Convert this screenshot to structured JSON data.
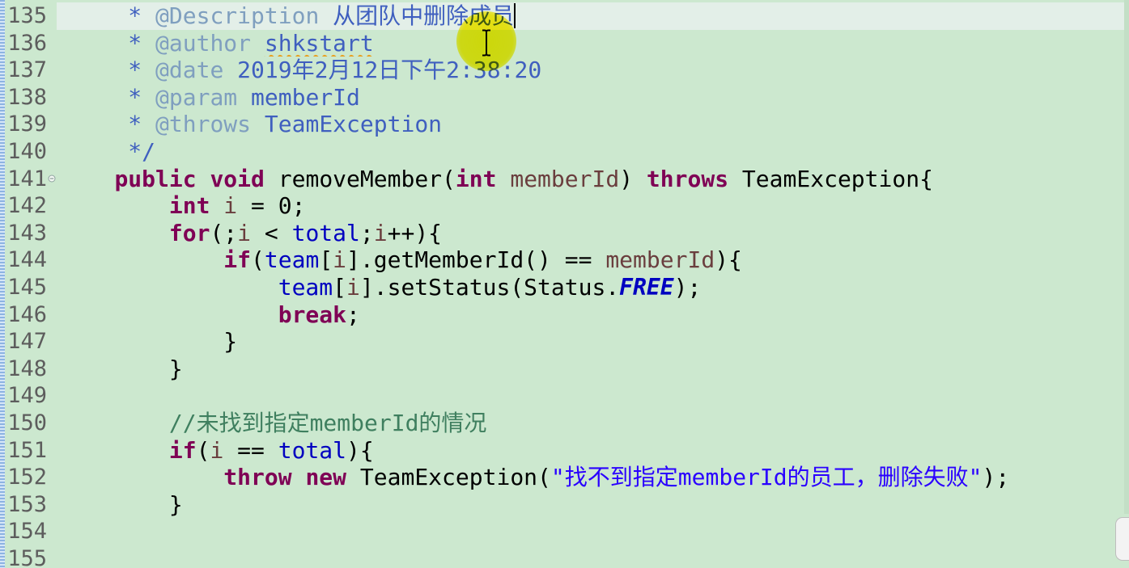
{
  "editor": {
    "colors": {
      "background": "#cce8cf",
      "current_line": "#e3efe8"
    },
    "syntax_colors": {
      "default": "#000000",
      "javadoc": "#3f5fbf",
      "javadoc_tag": "#7f9fbf",
      "keyword": "#7f0055",
      "local": "#6a3e3e",
      "field": "#0000c0",
      "comment": "#3f7f5f",
      "string": "#2a00ff"
    },
    "lines": [
      {
        "number": "135",
        "current": true,
        "caret": true,
        "tokens": [
          {
            "t": "     "
          },
          {
            "k": "jd",
            "t": "*"
          },
          {
            "t": " "
          },
          {
            "k": "tag",
            "t": "@Description"
          },
          {
            "t": " "
          },
          {
            "k": "jd",
            "t": "从团队中删除成员"
          }
        ]
      },
      {
        "number": "136",
        "tokens": [
          {
            "t": "     "
          },
          {
            "k": "jd",
            "t": "*"
          },
          {
            "t": " "
          },
          {
            "k": "tag",
            "t": "@author"
          },
          {
            "t": " "
          },
          {
            "k": "spell",
            "t": "shkstart"
          }
        ]
      },
      {
        "number": "137",
        "tokens": [
          {
            "t": "     "
          },
          {
            "k": "jd",
            "t": "*"
          },
          {
            "t": " "
          },
          {
            "k": "tag",
            "t": "@date"
          },
          {
            "t": " "
          },
          {
            "k": "jd",
            "t": "2019年2月12日下午2:38:20"
          }
        ]
      },
      {
        "number": "138",
        "tokens": [
          {
            "t": "     "
          },
          {
            "k": "jd",
            "t": "*"
          },
          {
            "t": " "
          },
          {
            "k": "tag",
            "t": "@param"
          },
          {
            "t": " "
          },
          {
            "k": "jd",
            "t": "memberId"
          }
        ]
      },
      {
        "number": "139",
        "tokens": [
          {
            "t": "     "
          },
          {
            "k": "jd",
            "t": "*"
          },
          {
            "t": " "
          },
          {
            "k": "tag",
            "t": "@throws"
          },
          {
            "t": " "
          },
          {
            "k": "jd",
            "t": "TeamException"
          }
        ]
      },
      {
        "number": "140",
        "tokens": [
          {
            "t": "     "
          },
          {
            "k": "jd",
            "t": "*/"
          }
        ]
      },
      {
        "number": "141",
        "fold": "minus-circle-icon",
        "tokens": [
          {
            "t": "    "
          },
          {
            "k": "kw",
            "t": "public"
          },
          {
            "t": " "
          },
          {
            "k": "kw",
            "t": "void"
          },
          {
            "t": " removeMember("
          },
          {
            "k": "kw",
            "t": "int"
          },
          {
            "t": " "
          },
          {
            "k": "var",
            "t": "memberId"
          },
          {
            "t": ") "
          },
          {
            "k": "kw",
            "t": "throws"
          },
          {
            "t": " TeamException{"
          }
        ]
      },
      {
        "number": "142",
        "tokens": [
          {
            "t": "        "
          },
          {
            "k": "kw",
            "t": "int"
          },
          {
            "t": " "
          },
          {
            "k": "var",
            "t": "i"
          },
          {
            "t": " = 0;"
          }
        ]
      },
      {
        "number": "143",
        "tokens": [
          {
            "t": "        "
          },
          {
            "k": "kw",
            "t": "for"
          },
          {
            "t": "(;"
          },
          {
            "k": "var",
            "t": "i"
          },
          {
            "t": " < "
          },
          {
            "k": "fld",
            "t": "total"
          },
          {
            "t": ";"
          },
          {
            "k": "var",
            "t": "i"
          },
          {
            "t": "++){"
          }
        ]
      },
      {
        "number": "144",
        "tokens": [
          {
            "t": "            "
          },
          {
            "k": "kw",
            "t": "if"
          },
          {
            "t": "("
          },
          {
            "k": "fld",
            "t": "team"
          },
          {
            "t": "["
          },
          {
            "k": "var",
            "t": "i"
          },
          {
            "t": "].getMemberId() == "
          },
          {
            "k": "var",
            "t": "memberId"
          },
          {
            "t": "){"
          }
        ]
      },
      {
        "number": "145",
        "tokens": [
          {
            "t": "                "
          },
          {
            "k": "fld",
            "t": "team"
          },
          {
            "t": "["
          },
          {
            "k": "var",
            "t": "i"
          },
          {
            "t": "].setStatus(Status."
          },
          {
            "k": "st",
            "t": "FREE"
          },
          {
            "t": ");"
          }
        ]
      },
      {
        "number": "146",
        "tokens": [
          {
            "t": "                "
          },
          {
            "k": "kw",
            "t": "break"
          },
          {
            "t": ";"
          }
        ]
      },
      {
        "number": "147",
        "tokens": [
          {
            "t": "            "
          },
          {
            "t": "}"
          }
        ]
      },
      {
        "number": "148",
        "tokens": [
          {
            "t": "        "
          },
          {
            "t": "}"
          }
        ]
      },
      {
        "number": "149",
        "tokens": []
      },
      {
        "number": "150",
        "tokens": [
          {
            "t": "        "
          },
          {
            "k": "cm",
            "t": "//未找到指定memberId的情况"
          }
        ]
      },
      {
        "number": "151",
        "tokens": [
          {
            "t": "        "
          },
          {
            "k": "kw",
            "t": "if"
          },
          {
            "t": "("
          },
          {
            "k": "var",
            "t": "i"
          },
          {
            "t": " == "
          },
          {
            "k": "fld",
            "t": "total"
          },
          {
            "t": "){"
          }
        ]
      },
      {
        "number": "152",
        "tokens": [
          {
            "t": "            "
          },
          {
            "k": "kw",
            "t": "throw"
          },
          {
            "t": " "
          },
          {
            "k": "kw",
            "t": "new"
          },
          {
            "t": " TeamException("
          },
          {
            "k": "str",
            "t": "\"找不到指定memberId的员工，删除失败\""
          },
          {
            "t": ");"
          }
        ]
      },
      {
        "number": "153",
        "tokens": [
          {
            "t": "        "
          },
          {
            "t": "}"
          }
        ]
      },
      {
        "number": "154",
        "tokens": []
      },
      {
        "number": "155",
        "tokens": []
      }
    ]
  }
}
